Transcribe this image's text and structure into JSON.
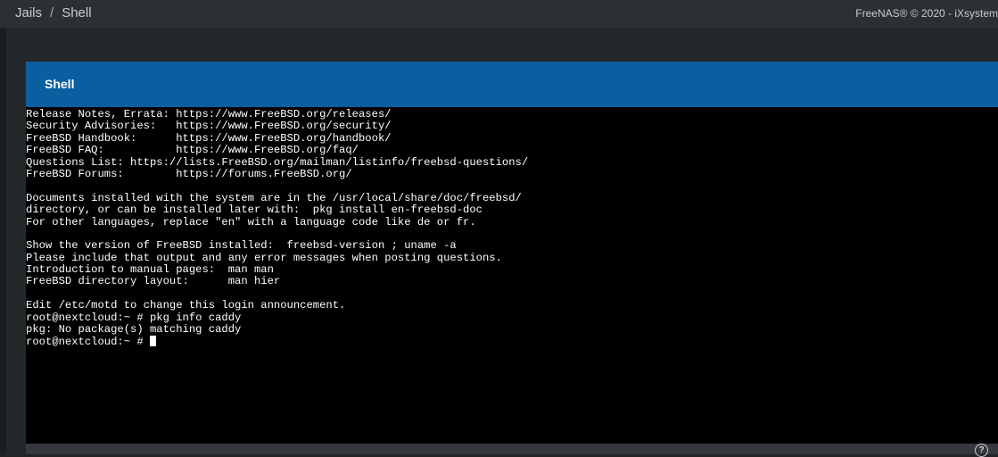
{
  "breadcrumb": {
    "items": [
      "Jails",
      "Shell"
    ],
    "separator": "/"
  },
  "header": {
    "copyright": "FreeNAS® © 2020 - iXsystem"
  },
  "card": {
    "title": "Shell"
  },
  "terminal": {
    "lines": [
      "Release Notes, Errata: https://www.FreeBSD.org/releases/",
      "Security Advisories:   https://www.FreeBSD.org/security/",
      "FreeBSD Handbook:      https://www.FreeBSD.org/handbook/",
      "FreeBSD FAQ:           https://www.FreeBSD.org/faq/",
      "Questions List: https://lists.FreeBSD.org/mailman/listinfo/freebsd-questions/",
      "FreeBSD Forums:        https://forums.FreeBSD.org/",
      "",
      "Documents installed with the system are in the /usr/local/share/doc/freebsd/",
      "directory, or can be installed later with:  pkg install en-freebsd-doc",
      "For other languages, replace \"en\" with a language code like de or fr.",
      "",
      "Show the version of FreeBSD installed:  freebsd-version ; uname -a",
      "Please include that output and any error messages when posting questions.",
      "Introduction to manual pages:  man man",
      "FreeBSD directory layout:      man hier",
      "",
      "Edit /etc/motd to change this login announcement.",
      "root@nextcloud:~ # pkg info caddy",
      "pkg: No package(s) matching caddy"
    ],
    "prompt": "root@nextcloud:~ # "
  },
  "icons": {
    "help": "help-circle-icon"
  },
  "colors": {
    "header_blue": "#0a5fa0",
    "terminal_bg": "#000000",
    "terminal_fg": "#ffffff",
    "page_bg": "#25282b"
  }
}
